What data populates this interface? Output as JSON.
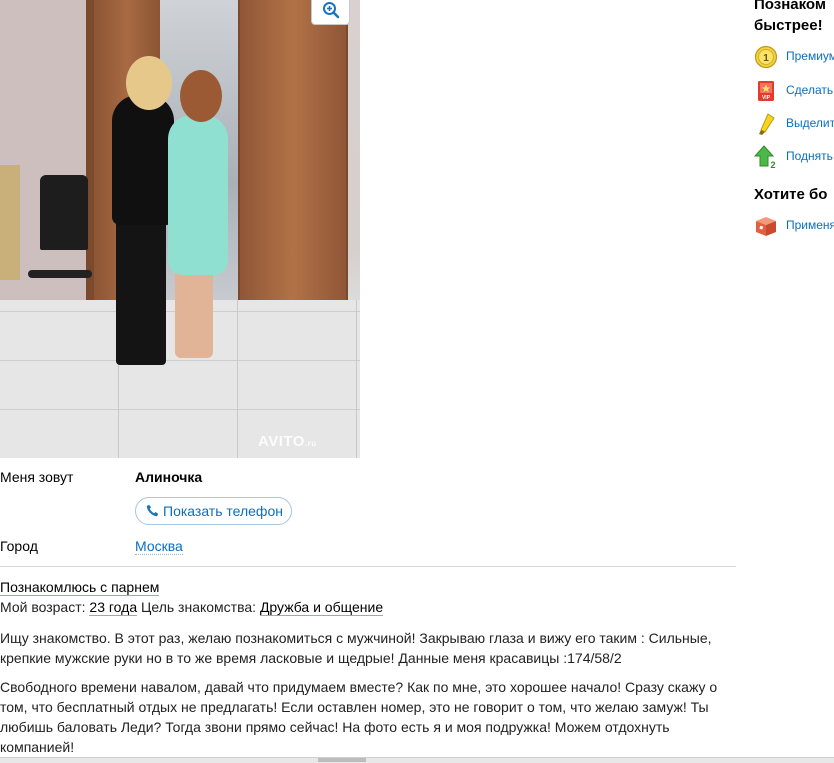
{
  "photo": {
    "watermark": "AVITO",
    "watermark_suffix": ".ru"
  },
  "params": {
    "name_label": "Меня зовут",
    "name_value": "Алиночка",
    "phone_button": "Показать телефон",
    "city_label": "Город",
    "city_value": "Москва"
  },
  "description": {
    "category": "Познакомлюсь с парнем",
    "age_label": "Мой возраст:",
    "age_value": "23 года",
    "goal_label": "Цель знакомства:",
    "goal_value": "Дружба и общение",
    "paragraph1": "Ищу знакомство. В этот раз, желаю познакомиться с мужчиной! Закрываю глаза и вижу его таким : Сильные, крепкие мужские руки но в то же время ласковые и щедрые! Данные меня красавицы :174/58/2",
    "paragraph2": "Свободного времени навалом, давай что придумаем вместе? Как по мне, это хорошее начало! Сразу скажу о том, что бесплатный отдых не предлагать! Если оставлен номер, это не говорит о том, что желаю замуж! Ты любишь баловать Леди? Тогда звони прямо сейчас! На фото есть я и моя подружка! Можем отдохнуть компанией!"
  },
  "sidebar": {
    "title_line1": "Познаком",
    "title_line2": "быстрее!",
    "items": [
      {
        "icon": "premium-coin-icon",
        "label": "Премиум"
      },
      {
        "icon": "vip-icon",
        "label": "Сделать"
      },
      {
        "icon": "highlight-marker-icon",
        "label": "Выделит"
      },
      {
        "icon": "raise-arrow-icon",
        "label": "Поднять"
      }
    ],
    "title2": "Хотите бо",
    "package_item": {
      "icon": "package-box-icon",
      "label": "Применя"
    }
  },
  "colors": {
    "link": "#0a6fbf",
    "divider": "#d8d8d8"
  }
}
